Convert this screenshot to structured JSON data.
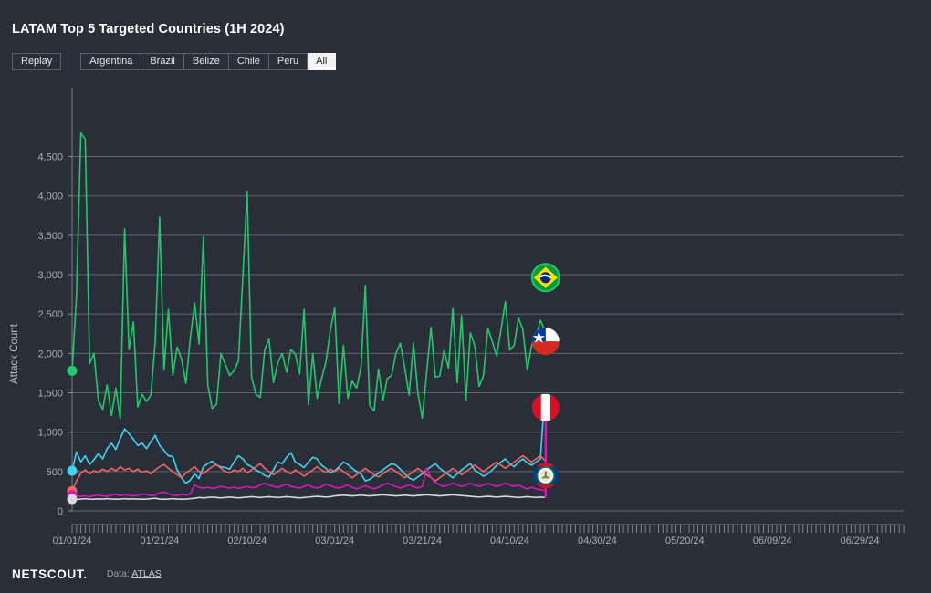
{
  "header": {
    "title": "LATAM Top 5 Targeted Countries (1H 2024)",
    "replay_label": "Replay",
    "country_buttons": [
      {
        "label": "Argentina",
        "active": false
      },
      {
        "label": "Brazil",
        "active": false
      },
      {
        "label": "Belize",
        "active": false
      },
      {
        "label": "Chile",
        "active": false
      },
      {
        "label": "Peru",
        "active": false
      },
      {
        "label": "All",
        "active": true
      }
    ]
  },
  "footer": {
    "brand": "NETSCOUT.",
    "data_prefix": "Data:",
    "data_source": "ATLAS"
  },
  "colors": {
    "background": "#2a2e39",
    "gridline": "#8e939e",
    "axis": "#8e939e",
    "tick_text": "#a8adb8",
    "brazil": "#21c96a",
    "chile": "#3fd5f0",
    "peru": "#f2675f",
    "argentina": "#d61ab8",
    "belize": "#d7dae0",
    "active_button_bg": "#f4f4f4",
    "active_button_text": "#23262f"
  },
  "chart_data": {
    "type": "line",
    "title": "LATAM Top 5 Targeted Countries (1H 2024)",
    "xlabel": "",
    "ylabel": "Attack Count",
    "ylim": [
      0,
      4900
    ],
    "yticks": [
      0,
      500,
      1000,
      1500,
      2000,
      2500,
      3000,
      3500,
      4000,
      4500
    ],
    "ytick_labels": [
      "0",
      "500",
      "1,000",
      "1,500",
      "2,000",
      "2,500",
      "3,000",
      "3,500",
      "4,000",
      "4,500"
    ],
    "xlim": [
      "01/01/24",
      "07/09/24"
    ],
    "xticks": [
      "01/01/24",
      "01/21/24",
      "02/10/24",
      "03/01/24",
      "03/21/24",
      "04/10/24",
      "04/30/24",
      "05/20/24",
      "06/09/24",
      "06/29/24"
    ],
    "grid": true,
    "legend": "markers",
    "x_days_total": 191,
    "data_days": 109,
    "series": [
      {
        "name": "Brazil",
        "color": "#21c96a",
        "marker": "brazil-flag",
        "start_value": 1780,
        "end_value": 2290,
        "values": [
          1780,
          2730,
          4800,
          4720,
          1870,
          2000,
          1400,
          1290,
          1600,
          1210,
          1560,
          1170,
          3580,
          2050,
          2400,
          1320,
          1480,
          1390,
          1470,
          2160,
          3730,
          1790,
          2560,
          1720,
          2080,
          1930,
          1620,
          2190,
          2640,
          2120,
          3480,
          1600,
          1300,
          1350,
          2000,
          1860,
          1720,
          1780,
          1900,
          2960,
          4060,
          1700,
          1480,
          1440,
          2050,
          2180,
          1630,
          1880,
          2000,
          1760,
          2050,
          1990,
          1740,
          2560,
          1350,
          2000,
          1430,
          1680,
          1890,
          2290,
          2580,
          1360,
          2100,
          1430,
          1650,
          1560,
          1820,
          2860,
          1340,
          1270,
          1800,
          1400,
          1680,
          1720,
          2000,
          2130,
          1820,
          1470,
          2130,
          1500,
          1180,
          1750,
          2330,
          1700,
          1710,
          2040,
          1810,
          2570,
          1630,
          2480,
          1400,
          2260,
          2100,
          1580,
          1720,
          2320,
          2150,
          1970,
          2300,
          2660,
          2040,
          2100,
          2450,
          2300,
          1790,
          2100,
          2200,
          2420,
          2290
        ]
      },
      {
        "name": "Chile",
        "color": "#3fd5f0",
        "marker": "chile-flag",
        "start_value": 510,
        "end_value": 1480,
        "values": [
          510,
          750,
          620,
          700,
          590,
          650,
          730,
          660,
          790,
          860,
          780,
          920,
          1040,
          980,
          910,
          830,
          860,
          790,
          880,
          960,
          830,
          770,
          700,
          690,
          520,
          420,
          350,
          390,
          470,
          410,
          560,
          600,
          630,
          580,
          560,
          550,
          530,
          620,
          700,
          660,
          590,
          560,
          520,
          490,
          450,
          430,
          520,
          620,
          600,
          680,
          740,
          620,
          590,
          550,
          620,
          680,
          660,
          580,
          540,
          480,
          510,
          560,
          620,
          590,
          540,
          500,
          470,
          380,
          400,
          440,
          480,
          520,
          560,
          600,
          580,
          530,
          470,
          420,
          390,
          430,
          470,
          520,
          560,
          600,
          540,
          500,
          460,
          420,
          470,
          520,
          560,
          600,
          520,
          480,
          440,
          470,
          520,
          580,
          620,
          660,
          600,
          560,
          620,
          660,
          610,
          580,
          620,
          660,
          1480
        ]
      },
      {
        "name": "Peru",
        "color": "#f2675f",
        "marker": "peru-flag",
        "start_value": 250,
        "end_value": 640,
        "values": [
          250,
          380,
          480,
          520,
          470,
          510,
          490,
          530,
          500,
          540,
          510,
          560,
          520,
          540,
          500,
          530,
          490,
          510,
          470,
          520,
          560,
          590,
          540,
          500,
          460,
          420,
          480,
          520,
          560,
          500,
          470,
          520,
          560,
          590,
          540,
          500,
          480,
          520,
          500,
          540,
          480,
          520,
          560,
          600,
          540,
          500,
          460,
          500,
          540,
          500,
          470,
          520,
          480,
          440,
          480,
          520,
          560,
          520,
          490,
          530,
          500,
          540,
          500,
          460,
          420,
          460,
          500,
          540,
          500,
          460,
          430,
          470,
          510,
          540,
          500,
          460,
          420,
          460,
          500,
          540,
          500,
          460,
          420,
          380,
          420,
          460,
          500,
          540,
          500,
          460,
          500,
          540,
          580,
          540,
          500,
          540,
          580,
          620,
          580,
          540,
          580,
          620,
          660,
          700,
          660,
          620,
          660,
          700,
          640
        ]
      },
      {
        "name": "Argentina",
        "color": "#d61ab8",
        "marker": null,
        "start_value": 200,
        "end_value": 260,
        "values": [
          200,
          190,
          185,
          190,
          180,
          195,
          200,
          190,
          185,
          200,
          210,
          195,
          205,
          200,
          190,
          200,
          215,
          210,
          195,
          200,
          230,
          240,
          220,
          200,
          195,
          210,
          200,
          215,
          330,
          300,
          290,
          300,
          285,
          295,
          310,
          300,
          290,
          300,
          285,
          300,
          310,
          295,
          300,
          330,
          350,
          330,
          310,
          300,
          320,
          340,
          310,
          300,
          290,
          310,
          330,
          300,
          290,
          310,
          340,
          320,
          300,
          290,
          310,
          330,
          300,
          280,
          300,
          320,
          300,
          280,
          300,
          330,
          350,
          330,
          310,
          290,
          310,
          330,
          310,
          290,
          310,
          540,
          420,
          360,
          330,
          310,
          330,
          350,
          330,
          310,
          330,
          350,
          330,
          310,
          330,
          350,
          330,
          310,
          330,
          350,
          330,
          310,
          330,
          300,
          280,
          300,
          280,
          270,
          260
        ]
      },
      {
        "name": "Belize",
        "color": "#d7dae0",
        "marker": "belize-flag",
        "start_value": 150,
        "end_value": 170,
        "values": [
          150,
          145,
          150,
          155,
          150,
          148,
          152,
          150,
          155,
          150,
          148,
          150,
          155,
          150,
          152,
          150,
          148,
          150,
          155,
          160,
          150,
          148,
          150,
          155,
          150,
          148,
          150,
          155,
          160,
          170,
          165,
          170,
          175,
          170,
          165,
          170,
          175,
          170,
          165,
          170,
          175,
          180,
          175,
          170,
          175,
          180,
          175,
          170,
          175,
          180,
          175,
          170,
          165,
          170,
          175,
          180,
          185,
          180,
          175,
          180,
          190,
          195,
          200,
          195,
          190,
          195,
          200,
          195,
          190,
          195,
          200,
          205,
          200,
          195,
          190,
          195,
          200,
          195,
          190,
          195,
          200,
          205,
          200,
          195,
          190,
          195,
          200,
          205,
          200,
          195,
          190,
          185,
          180,
          175,
          180,
          185,
          180,
          175,
          180,
          185,
          180,
          175,
          170,
          175,
          180,
          175,
          170,
          175,
          170
        ]
      }
    ]
  }
}
